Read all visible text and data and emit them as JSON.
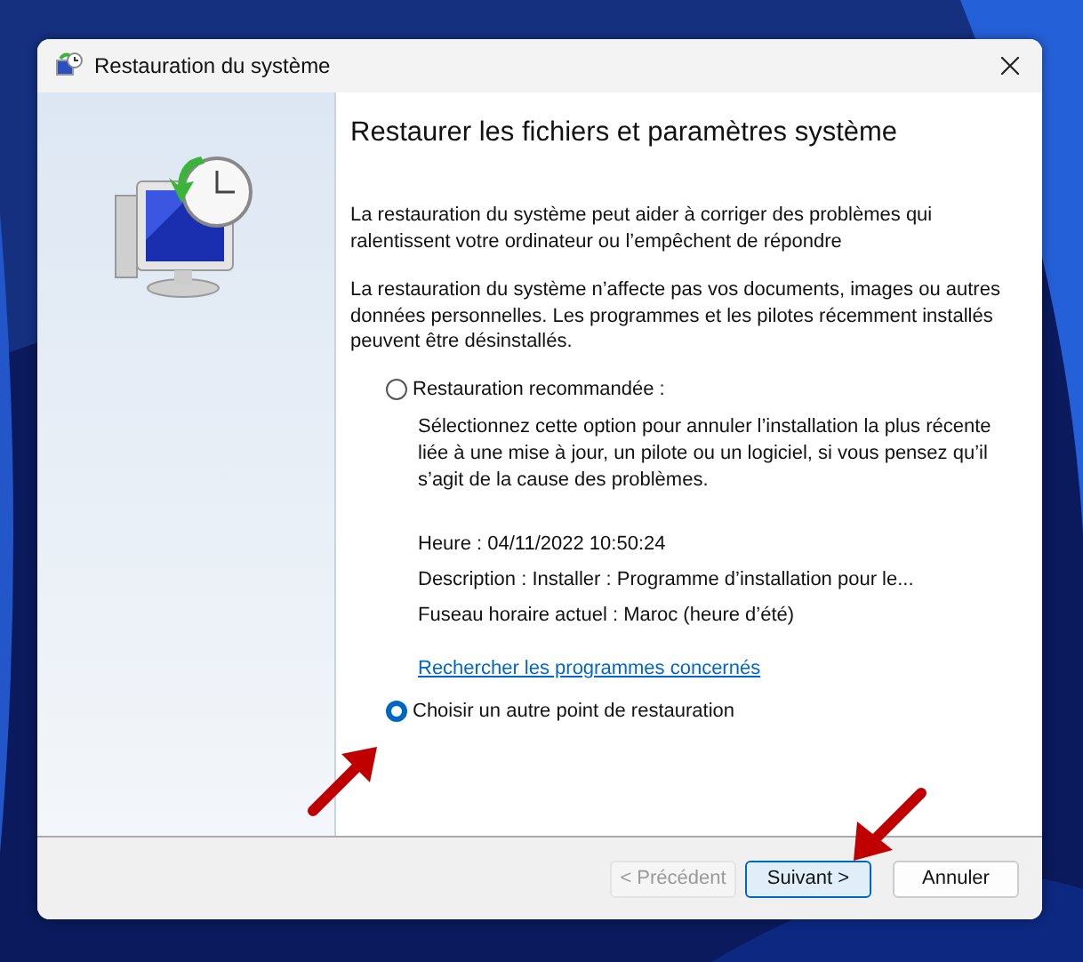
{
  "window": {
    "title": "Restauration du système"
  },
  "heading": "Restaurer les fichiers et paramètres système",
  "paragraphs": [
    "La restauration du système peut aider à corriger des problèmes qui ralentissent votre ordinateur ou l’empêchent de répondre",
    "La restauration du système n’affecte pas vos documents, images ou autres données personnelles. Les programmes et les pilotes récemment installés peuvent être désinstallés."
  ],
  "options": [
    {
      "label": "Restauration recommandée :",
      "selected": false,
      "description": "Sélectionnez cette option pour annuler l’installation la plus récente liée à une mise à jour, un pilote ou un logiciel, si vous pensez qu’il s’agit de la cause des problèmes.",
      "details": [
        "Heure : 04/11/2022 10:50:24",
        "Description : Installer : Programme d’installation pour le...",
        "Fuseau horaire actuel : Maroc (heure d’été)"
      ],
      "link": "Rechercher les programmes concernés"
    },
    {
      "label": "Choisir un autre point de restauration",
      "selected": true
    }
  ],
  "buttons": [
    {
      "label": "< Précédent",
      "disabled": true,
      "default": false
    },
    {
      "label": "Suivant >",
      "disabled": false,
      "default": true
    },
    {
      "label": "Annuler",
      "disabled": false,
      "default": false
    }
  ]
}
